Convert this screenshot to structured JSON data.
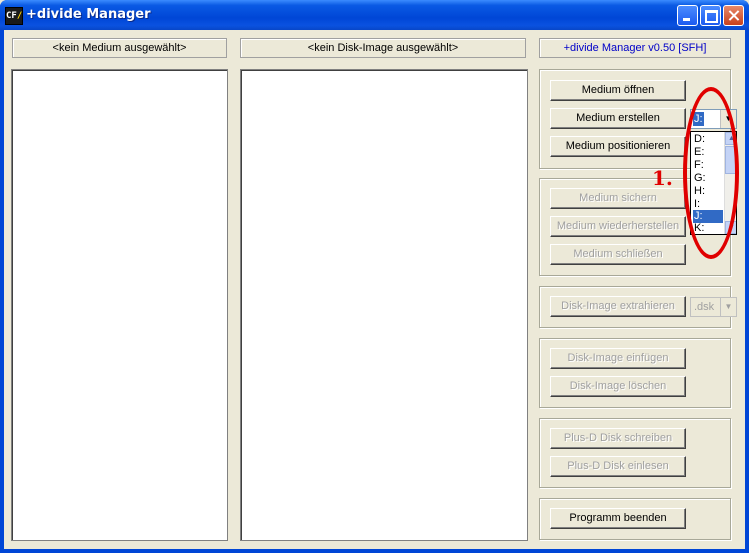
{
  "window": {
    "title": "+divide Manager",
    "icon_label": "CF"
  },
  "headers": {
    "medium": "<kein Medium ausgewählt>",
    "disk_image": "<kein Disk-Image ausgewählt>",
    "version": "+divide Manager v0.50 [SFH]"
  },
  "buttons": {
    "medium_oeffnen": "Medium öffnen",
    "medium_erstellen": "Medium erstellen",
    "medium_positionieren": "Medium positionieren",
    "medium_sichern": "Medium sichern",
    "medium_wiederherstellen": "Medium wiederherstellen",
    "medium_schliessen": "Medium schließen",
    "disk_image_extrahieren": "Disk-Image extrahieren",
    "disk_image_einfuegen": "Disk-Image einfügen",
    "disk_image_loeschen": "Disk-Image löschen",
    "plusd_schreiben": "Plus-D Disk schreiben",
    "plusd_einlesen": "Plus-D Disk einlesen",
    "programm_beenden": "Programm beenden"
  },
  "drive_combo": {
    "value": "J:",
    "options": [
      "D:",
      "E:",
      "F:",
      "G:",
      "H:",
      "I:",
      "J:",
      "K:"
    ],
    "selected": "J:"
  },
  "extension_combo": {
    "value": ".dsk"
  },
  "annotation": {
    "label": "1.",
    "color": "#e00000"
  },
  "colors": {
    "titlebar": "#0a5ae4",
    "selection": "#316ac5",
    "version_text": "#0000c8"
  }
}
